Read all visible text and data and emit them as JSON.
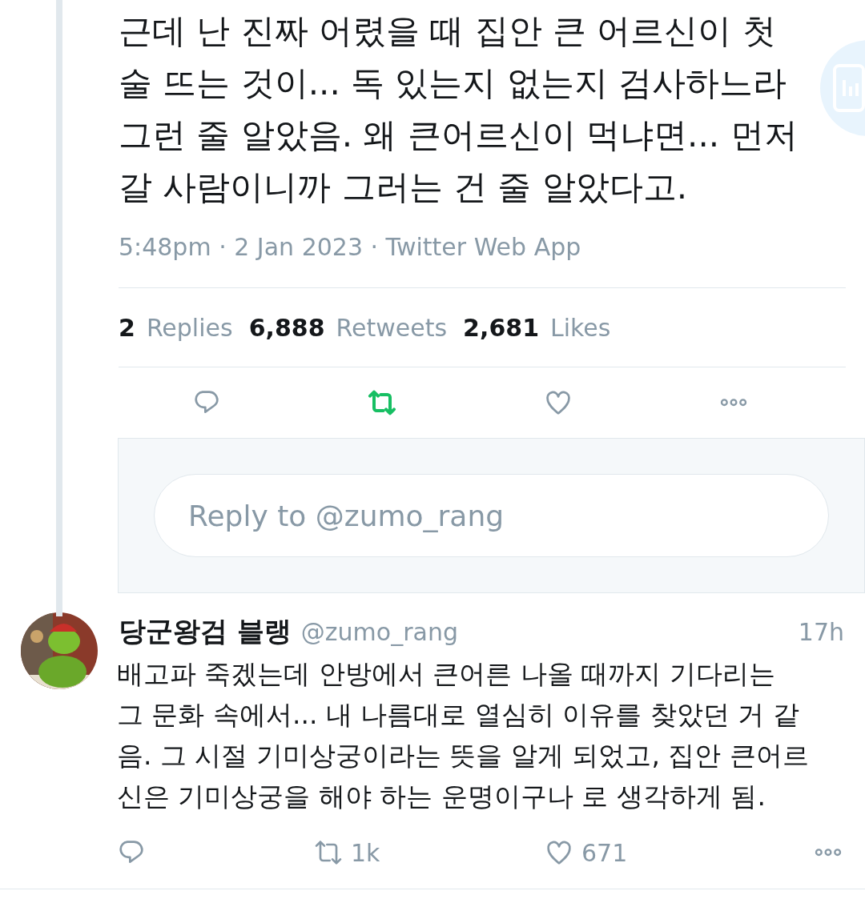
{
  "tweet": {
    "text_lines": [
      "근데 난 진짜 어렸을 때 집안 큰 어르신이 첫",
      "술 뜨는 것이... 독 있는지 없는지 검사하느라",
      "그런 줄 알았음. 왜 큰어르신이 먹냐면... 먼저",
      "갈 사람이니까 그러는 건 줄 알았다고."
    ],
    "meta": "5:48pm · 2 Jan 2023 · Twitter Web App",
    "stats": [
      {
        "count": "2",
        "label": "Replies"
      },
      {
        "count": "6,888",
        "label": "Retweets"
      },
      {
        "count": "2,681",
        "label": "Likes"
      }
    ],
    "retweeted": true,
    "liked": false
  },
  "reply_box": {
    "placeholder": "Reply to @zumo_rang"
  },
  "replies": [
    {
      "name": "당군왕검 블랭",
      "handle": "@zumo_rang",
      "time": "17h",
      "text_lines": [
        "배고파 죽겠는데 안방에서 큰어른 나올 때까지 기다리는",
        "그 문화 속에서... 내 나름대로 열심히 이유를 찾았던 거 같",
        "음. 그 시절 기미상궁이라는 뜻을 알게 되었고, 집안 큰어르",
        "신은 기미상궁을 해야 하는 운명이구나 로 생각하게 됨."
      ],
      "retweets": "1k",
      "likes": "671",
      "retweeted": false,
      "liked": false
    }
  ]
}
